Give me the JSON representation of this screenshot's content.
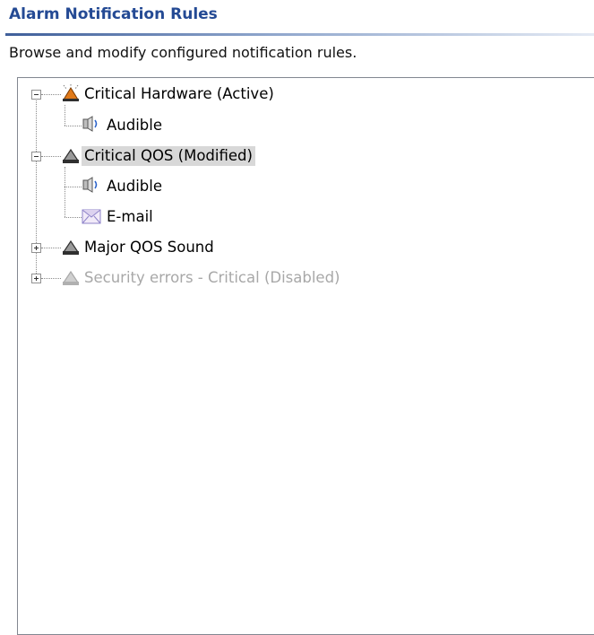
{
  "header": {
    "title": "Alarm Notification Rules",
    "subtitle": "Browse and modify configured notification rules."
  },
  "colors": {
    "title": "#244a94",
    "active_bell": "#e07a1a",
    "normal_bell": "#3a3a3a",
    "disabled_bell": "#b0b0b0",
    "selection": "#d8d8d8"
  },
  "tree": {
    "rules": [
      {
        "label": "Critical Hardware (Active)",
        "state": "active",
        "icon": "bell-active-icon",
        "expanded": true,
        "children": [
          {
            "label": "Audible",
            "icon": "speaker-icon"
          }
        ]
      },
      {
        "label": "Critical QOS (Modified)",
        "state": "modified",
        "icon": "bell-icon",
        "expanded": true,
        "selected": true,
        "children": [
          {
            "label": "Audible",
            "icon": "speaker-icon"
          },
          {
            "label": "E-mail",
            "icon": "envelope-icon"
          }
        ]
      },
      {
        "label": "Major QOS Sound",
        "state": "normal",
        "icon": "bell-icon",
        "expanded": false
      },
      {
        "label": "Security errors - Critical (Disabled)",
        "state": "disabled",
        "icon": "bell-disabled-icon",
        "expanded": false
      }
    ]
  }
}
